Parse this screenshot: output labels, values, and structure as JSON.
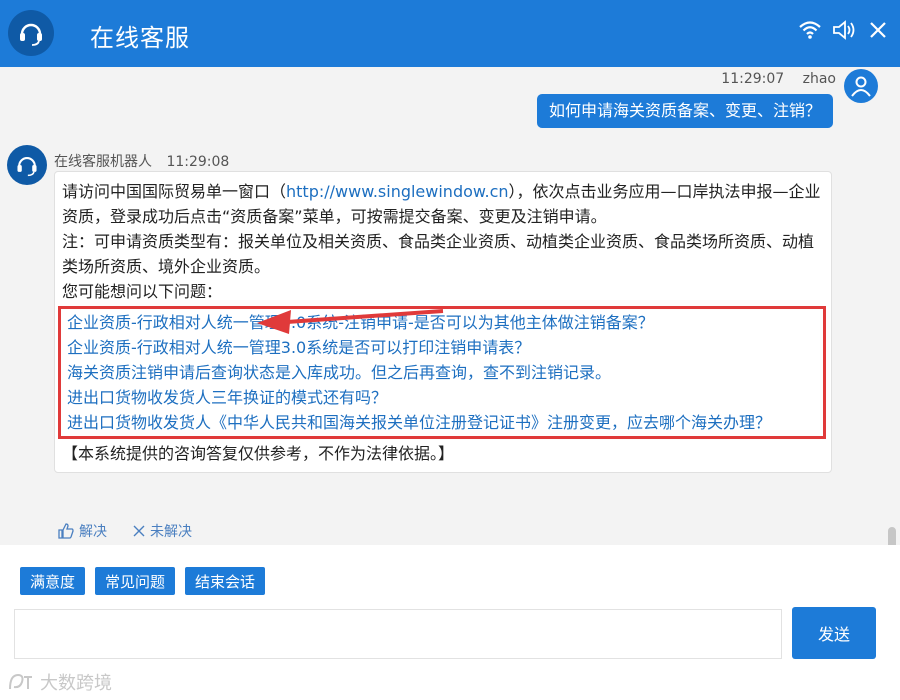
{
  "header": {
    "title": "在线客服"
  },
  "user": {
    "time": "11:29:07",
    "name": "zhao",
    "message": "如何申请海关资质备案、变更、注销？"
  },
  "bot": {
    "name": "在线客服机器人",
    "time": "11:29:08",
    "answer_pre": "请访问中国国际贸易单一窗口（",
    "answer_url": "http://www.singlewindow.cn",
    "answer_post": "），依次点击业务应用—口岸执法申报—企业资质，登录成功后点击“资质备案”菜单，可按需提交备案、变更及注销申请。",
    "note": "注：可申请资质类型有：报关单位及相关资质、食品类企业资质、动植类企业资质、食品类场所资质、动植类场所资质、境外企业资质。",
    "suggest_intro": "您可能想问以下问题：",
    "questions": [
      "企业资质-行政相对人统一管理3.0系统-注销申请-是否可以为其他主体做注销备案？",
      "企业资质-行政相对人统一管理3.0系统是否可以打印注销申请表？",
      "海关资质注销申请后查询状态是入库成功。但之后再查询，查不到注销记录。",
      "进出口货物收发货人三年换证的模式还有吗？",
      "进出口货物收发货人《中华人民共和国海关报关单位注册登记证书》注册变更，应去哪个海关办理？"
    ],
    "disclaimer": "【本系统提供的咨询答复仅供参考，不作为法律依据。】",
    "solved_label": "解决",
    "unsolved_label": "未解决"
  },
  "quick_actions": [
    "满意度",
    "常见问题",
    "结束会话"
  ],
  "send_label": "发送",
  "watermark": "大数跨境",
  "colors": {
    "header": "#1d7bd8",
    "highlight_box": "#e03a3a",
    "link": "#1d6fc0"
  }
}
